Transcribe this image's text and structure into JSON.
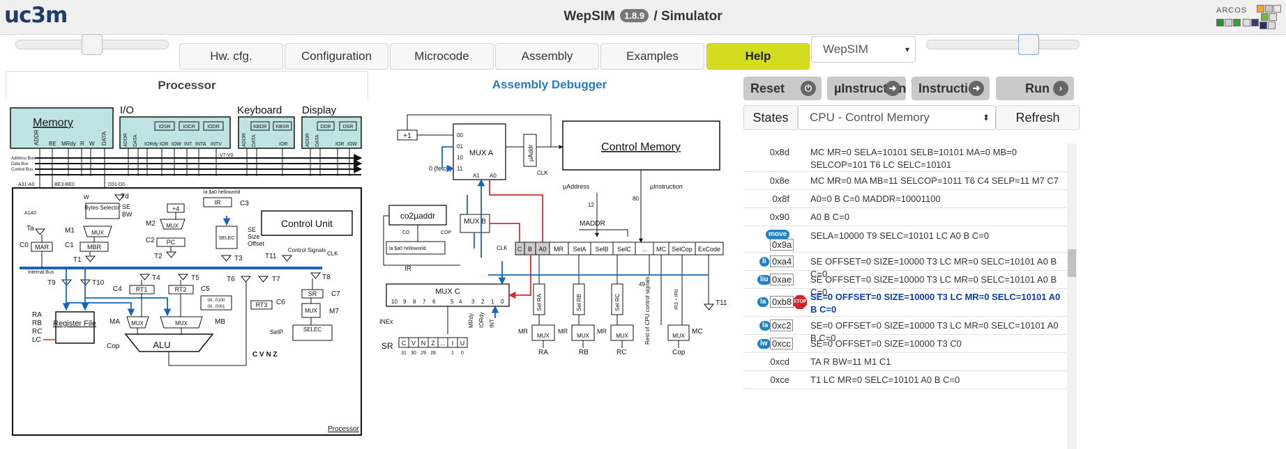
{
  "header": {
    "logo": "uc3m",
    "title_prefix": "WepSIM",
    "version": "1.8.9",
    "title_suffix": "/ Simulator",
    "partner_logo": "ARCOS"
  },
  "toolbar": {
    "tabs": [
      "Hw. cfg.",
      "Configuration",
      "Microcode",
      "Assembly",
      "Examples"
    ],
    "help_label": "Help",
    "mode_select": "WepSIM"
  },
  "left_panel": {
    "tabs": [
      {
        "label": "Processor",
        "active": true
      },
      {
        "label": "Assembly Debugger",
        "active": false
      }
    ]
  },
  "diagram": {
    "memory": "Memory",
    "memory_signals": [
      "ADDR",
      "BE",
      "MRdy",
      "R",
      "W",
      "DATA"
    ],
    "io": "I/O",
    "io_regs": [
      "IOSR",
      "IOCR",
      "IODR"
    ],
    "io_signals": [
      "ADDR",
      "DATA",
      "IORdy",
      "IOR",
      "IOW",
      "INT",
      "INTA",
      "INTV"
    ],
    "keyboard": "Keyboard",
    "kb_regs": [
      "KBDR",
      "KBSR"
    ],
    "kb_signals": [
      "ADDR",
      "DATA",
      "IOR"
    ],
    "display": "Display",
    "disp_regs": [
      "DDR",
      "DSR"
    ],
    "disp_signals": [
      "ADDR",
      "DATA",
      "IOR",
      "IOW"
    ],
    "buses": [
      "Address Bus",
      "Data Bus",
      "Control Bus"
    ],
    "bus_labels": [
      "A31-A0",
      "BE3-BE0",
      "D31-D0",
      "V7-V0"
    ],
    "bytes_selector": "Bytes Selector",
    "ir": "IR",
    "control_unit": "Control Unit",
    "control_signals": "Control Signals",
    "clk": "CLK",
    "la_text": "la $a0 helloworld",
    "selec": "SELEC",
    "selec_outs": [
      "SE",
      "Size",
      "Offset"
    ],
    "regs": [
      "MAR",
      "MBR",
      "PC",
      "RT1",
      "RT2",
      "RT3",
      "SR"
    ],
    "mux": "MUX",
    "register_file": "Register File",
    "reg_inputs": [
      "RA",
      "RB",
      "RC",
      "LC"
    ],
    "alu": "ALU",
    "flags": "C V N Z",
    "internal_bus": "Internal Bus",
    "processor": "Processor",
    "tristates": [
      "Ta",
      "Td",
      "T1",
      "T2",
      "T3",
      "T4",
      "T5",
      "T6",
      "T7",
      "T8",
      "T9",
      "T10",
      "T11"
    ],
    "controls": [
      "C0",
      "C1",
      "C2",
      "C3",
      "C4",
      "C5",
      "C6",
      "C7",
      "M1",
      "M2",
      "M7",
      "MA",
      "MB",
      "SE",
      "BW",
      "A1A0",
      "W",
      "SelP",
      "Cop"
    ],
    "plus4": "+4",
    "const_vals": [
      "00...0100",
      "00...0001"
    ],
    "plus1": "+1",
    "mux_a": "MUX A",
    "mux_a_inputs": [
      "00",
      "01",
      "10",
      "11"
    ],
    "fetch": "0 (fetch)",
    "a1a0": [
      "A1",
      "A0"
    ],
    "muaddr": "µAddr",
    "control_memory": "Control Memory",
    "uaddress": "µAddress",
    "uinstruction": "µInstruction",
    "co2muaddr": "co2µaddr",
    "co_cop": [
      "CO",
      "COP"
    ],
    "mux_b": "MUX B",
    "maddr": "MADDR",
    "maddr_bits": "12",
    "uinstr_bits": "80",
    "cw_fields": [
      "C",
      "B",
      "A0",
      "MR",
      "SelA",
      "SelB",
      "SelC",
      "...",
      "MC",
      "SelCop",
      "ExCode"
    ],
    "mux_c": "MUX C",
    "mux_c_inputs": [
      "10",
      "9",
      "8",
      "7",
      "6",
      "5",
      "4",
      "3",
      "2",
      "1",
      "0"
    ],
    "mux_c_labels": [
      "INEx",
      "MRdy",
      "IORdy",
      "INT"
    ],
    "sr_bits": [
      "C",
      "V",
      "N",
      "Z",
      "...",
      "I",
      "U"
    ],
    "sr_positions": [
      "31",
      "30",
      "29",
      "28",
      "1",
      "0"
    ],
    "sel_regs": [
      "Sel RA",
      "Sel RB",
      "Sel RC"
    ],
    "outs": [
      "RA",
      "RB",
      "RC",
      "Cop"
    ],
    "rest_cpu": "Rest of CPU control signals",
    "ir3": "IR3 ÷ IR0",
    "bits_49": "49",
    "bits_4": "4",
    "bits_5": "5",
    "mr": "MR",
    "mc": "MC"
  },
  "right_panel": {
    "buttons": [
      {
        "label": "Reset",
        "icon": "power-icon"
      },
      {
        "label": "µInstruction",
        "icon": "arrow-right-icon"
      },
      {
        "label": "Instruction",
        "icon": "arrow-right-icon"
      },
      {
        "label": "Run",
        "icon": "chevron-right-icon"
      }
    ],
    "states_label": "States",
    "state_select": "CPU - Control Memory",
    "refresh_label": "Refresh",
    "microcode": [
      {
        "addr": "0x8d",
        "code": "MC MR=0 SELA=10101 SELB=10101 MA=0 MB=0 SELCOP=101 T6 LC SELC=10101",
        "badge": ""
      },
      {
        "addr": "0x8e",
        "code": "MC MR=0 MA MB=11 SELCOP=1011 T6 C4 SELP=11 M7 C7",
        "badge": ""
      },
      {
        "addr": "0x8f",
        "code": "A0=0 B C=0 MADDR=10001100",
        "badge": ""
      },
      {
        "addr": "0x90",
        "code": "A0 B C=0",
        "badge": ""
      },
      {
        "addr": "0x9a",
        "code": "SELA=10000 T9 SELC=10101 LC A0 B C=0",
        "badge": "move"
      },
      {
        "addr": "0xa4",
        "code": "SE OFFSET=0 SIZE=10000 T3 LC MR=0 SELC=10101 A0 B C=0",
        "badge": "li"
      },
      {
        "addr": "0xae",
        "code": "SE OFFSET=0 SIZE=10000 T3 LC MR=0 SELC=10101 A0 B C=0",
        "badge": "liu"
      },
      {
        "addr": "0xb8",
        "code": "SE=0 OFFSET=0 SIZE=10000 T3 LC MR=0 SELC=10101 A0 B C=0",
        "badge": "la",
        "stop": "STOP",
        "current": true
      },
      {
        "addr": "0xc2",
        "code": "SE=0 OFFSET=0 SIZE=10000 T3 LC MR=0 SELC=10101 A0 B C=0",
        "badge": "la"
      },
      {
        "addr": "0xcc",
        "code": "SE=0 OFFSET=0 SIZE=10000 T3 C0",
        "badge": "lw"
      },
      {
        "addr": "0xcd",
        "code": "TA R BW=11 M1 C1",
        "badge": ""
      },
      {
        "addr": "0xce",
        "code": "T1 LC MR=0 SELC=10101 A0 B C=0",
        "badge": ""
      }
    ]
  },
  "colors": {
    "accent_help": "#d4dc1f",
    "link_blue": "#2a7bc1",
    "bus_blue": "#1565c0",
    "signal_red": "#d32f2f",
    "box_teal": "#bfe3e3",
    "badge_blue": "#1f82c4",
    "current_text": "#0b3ea6",
    "stop_red": "#d3222a"
  }
}
